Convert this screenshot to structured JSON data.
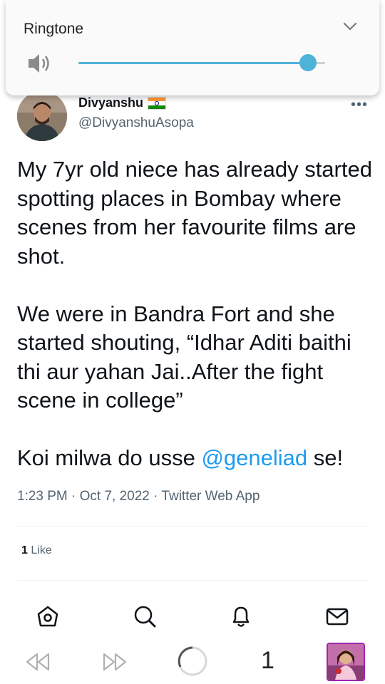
{
  "tweet": {
    "author_name": "Divyanshu",
    "author_handle": "@DivyanshuAsopa",
    "more_label": "•••",
    "text_main": "My 7yr old niece has already started spotting places in Bombay where scenes from her favourite films are shot.\n\nWe were in Bandra Fort and she started shouting, “Idhar Aditi baithi thi aur yahan Jai..After the fight scene in college”\n\nKoi milwa do usse ",
    "mention": "@geneliad",
    "text_end": " se!",
    "meta": "1:23 PM · Oct 7, 2022 · Twitter Web App",
    "like_count": "1",
    "like_label": "Like"
  },
  "nav": {
    "items": [
      "home-icon",
      "search-icon",
      "notifications-icon",
      "messages-icon"
    ]
  },
  "browser": {
    "tab_count": "1"
  },
  "volume_popup": {
    "title": "Ringtone",
    "level": 0.93,
    "accent": "#4fb3d9"
  },
  "colors": {
    "link": "#1d9bf0",
    "secondary": "#536471"
  }
}
